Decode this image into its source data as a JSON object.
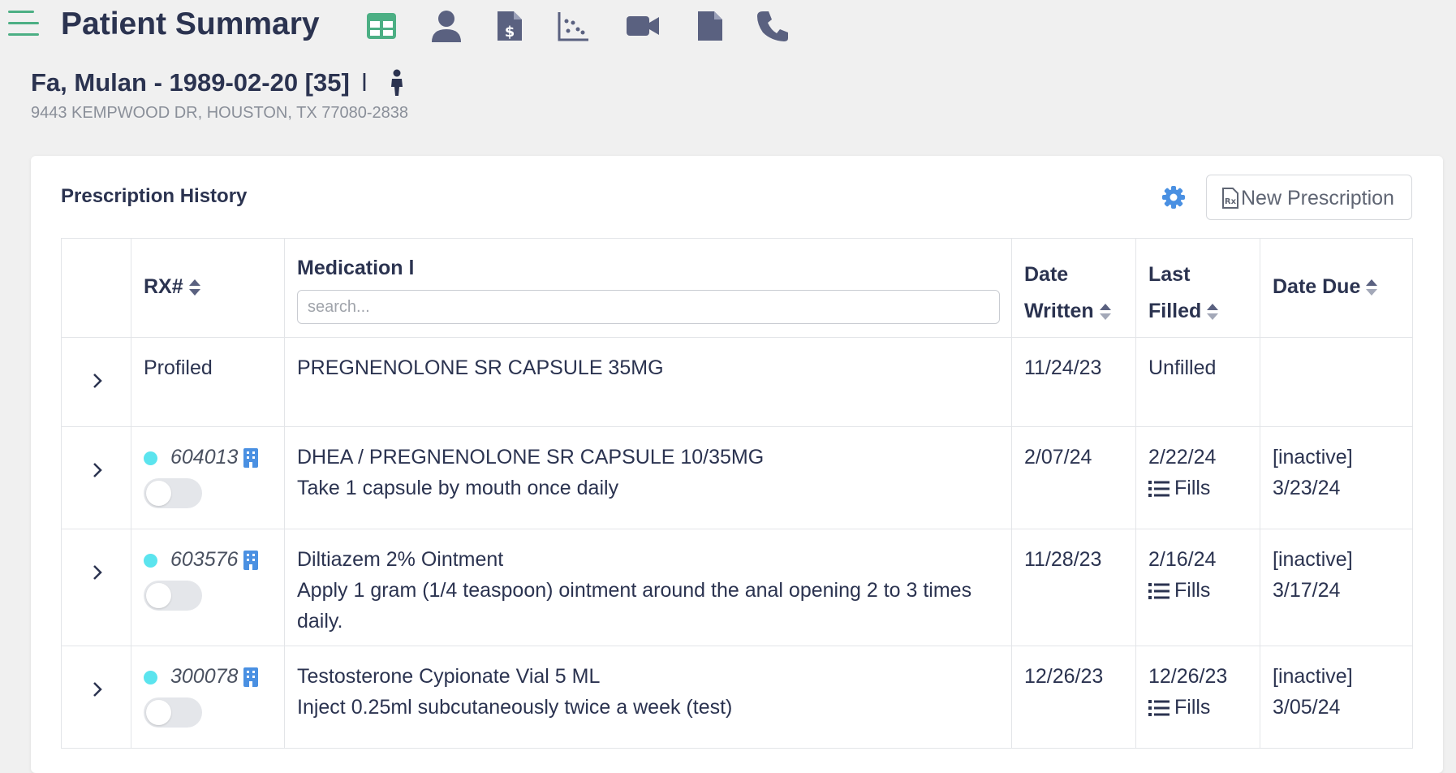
{
  "header": {
    "title": "Patient Summary",
    "toolbar_icons": [
      "spreadsheet-icon",
      "user-icon",
      "invoice-icon",
      "scatter-chart-icon",
      "video-icon",
      "file-icon",
      "phone-icon"
    ]
  },
  "patient": {
    "name_line": "Fa, Mulan - 1989-02-20 [35]",
    "separator": "l",
    "address": "9443 KEMPWOOD DR, HOUSTON, TX 77080-2838"
  },
  "rx_card": {
    "title": "Prescription History",
    "new_button_label": "New Prescription",
    "columns": {
      "rx": "RX#",
      "medication": "Medication l",
      "date_written_1": "Date",
      "date_written_2": "Written",
      "last_filled_1": "Last",
      "last_filled_2": "Filled",
      "date_due": "Date Due"
    },
    "search_placeholder": "search...",
    "rows": [
      {
        "rx": "Profiled",
        "medication": "PREGNENOLONE SR CAPSULE 35MG",
        "sig": "",
        "written": "11/24/23",
        "last_filled": "Unfilled",
        "fills_label": "",
        "due_status": "",
        "due_date": ""
      },
      {
        "rx": "604013",
        "medication": "DHEA / PREGNENOLONE SR CAPSULE 10/35MG",
        "sig": "Take 1 capsule by mouth once daily",
        "written": "2/07/24",
        "last_filled": "2/22/24",
        "fills_label": "Fills",
        "due_status": "[inactive]",
        "due_date": "3/23/24"
      },
      {
        "rx": "603576",
        "medication": "Diltiazem 2% Ointment",
        "sig": "Apply 1 gram (1/4 teaspoon) ointment around the anal opening 2 to 3 times daily.",
        "written": "11/28/23",
        "last_filled": "2/16/24",
        "fills_label": "Fills",
        "due_status": "[inactive]",
        "due_date": "3/17/24"
      },
      {
        "rx": "300078",
        "medication": "Testosterone Cypionate Vial 5 ML",
        "sig": "Inject 0.25ml subcutaneously twice a week (test)",
        "written": "12/26/23",
        "last_filled": "12/26/23",
        "fills_label": "Fills",
        "due_status": "[inactive]",
        "due_date": "3/05/24"
      }
    ]
  },
  "colors": {
    "accent_green": "#4caf84",
    "icon_slate": "#5a6180",
    "gear_blue": "#4a90e2",
    "status_dot": "#5be4ee"
  }
}
